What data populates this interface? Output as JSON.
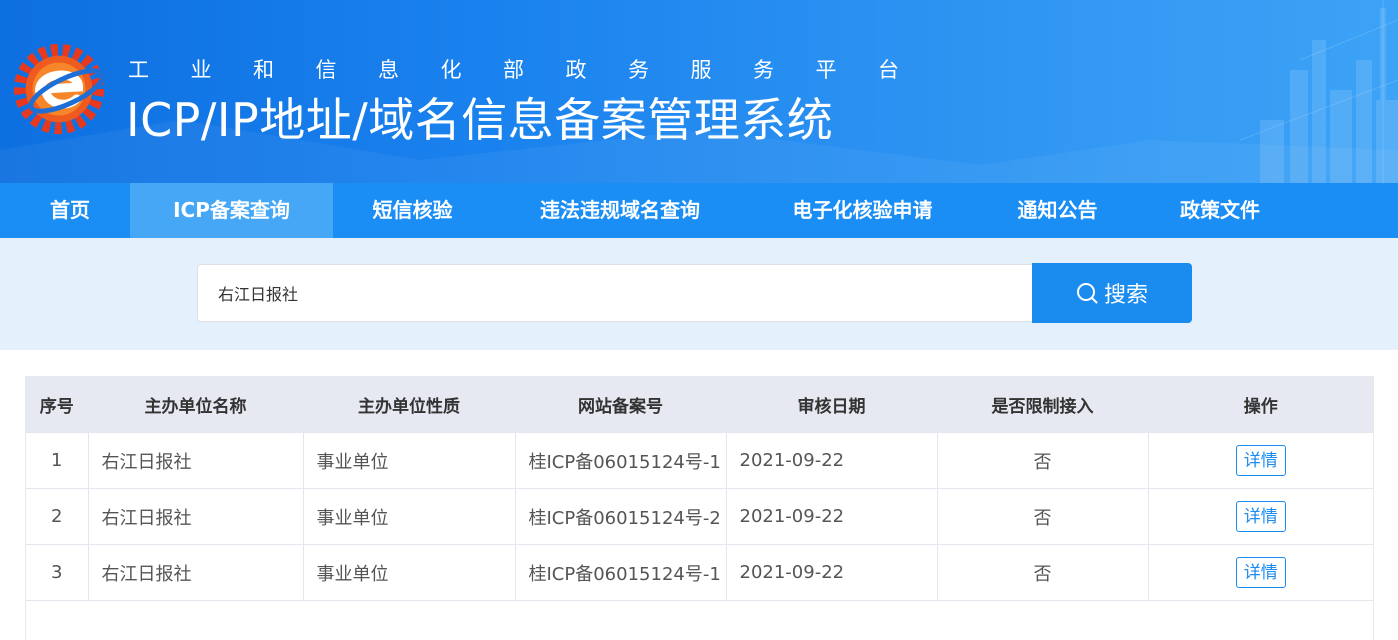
{
  "header": {
    "subtitle": "工业和信息化部政务服务平台",
    "title": "ICP/IP地址/域名信息备案管理系统"
  },
  "nav": {
    "items": [
      {
        "label": "首页"
      },
      {
        "label": "ICP备案查询",
        "active": true
      },
      {
        "label": "短信核验"
      },
      {
        "label": "违法违规域名查询"
      },
      {
        "label": "电子化核验申请"
      },
      {
        "label": "通知公告"
      },
      {
        "label": "政策文件"
      }
    ]
  },
  "search": {
    "value": "右江日报社",
    "button_label": "搜索"
  },
  "table": {
    "headers": [
      "序号",
      "主办单位名称",
      "主办单位性质",
      "网站备案号",
      "审核日期",
      "是否限制接入",
      "操作"
    ],
    "rows": [
      {
        "index": "1",
        "name": "右江日报社",
        "nature": "事业单位",
        "record_no": "桂ICP备06015124号-1",
        "date": "2021-09-22",
        "restricted": "否",
        "action": "详情"
      },
      {
        "index": "2",
        "name": "右江日报社",
        "nature": "事业单位",
        "record_no": "桂ICP备06015124号-2",
        "date": "2021-09-22",
        "restricted": "否",
        "action": "详情"
      },
      {
        "index": "3",
        "name": "右江日报社",
        "nature": "事业单位",
        "record_no": "桂ICP备06015124号-1",
        "date": "2021-09-22",
        "restricted": "否",
        "action": "详情"
      }
    ]
  },
  "colors": {
    "banner": "#1a82ee",
    "nav": "#1b8ef5",
    "nav_active": "#46a7f7",
    "accent": "#1a8cf0",
    "search_bg": "#e4f0fb"
  }
}
